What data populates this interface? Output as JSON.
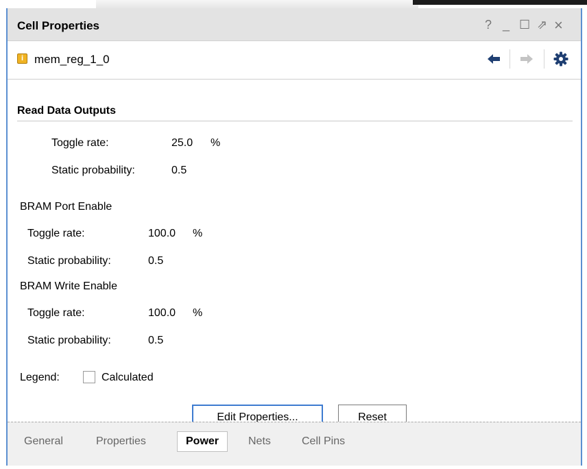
{
  "window": {
    "title": "Cell Properties",
    "controls": {
      "help": "?",
      "minimize": "_",
      "maximize": "☐",
      "float": "⇗",
      "close": "×"
    }
  },
  "cell": {
    "name": "mem_reg_1_0",
    "icon_glyph": "i"
  },
  "nav": {
    "back_icon": "arrow-left-icon",
    "forward_icon": "arrow-right-icon",
    "settings_icon": "gear-icon"
  },
  "read_data_outputs": {
    "heading": "Read Data Outputs",
    "toggle_label": "Toggle rate:",
    "toggle_value": "25.0",
    "toggle_unit": "%",
    "static_label": "Static probability:",
    "static_value": "0.5"
  },
  "bram_port_enable": {
    "heading": "BRAM Port Enable",
    "toggle_label": "Toggle rate:",
    "toggle_value": "100.0",
    "toggle_unit": "%",
    "static_label": "Static probability:",
    "static_value": "0.5"
  },
  "bram_write_enable": {
    "heading": "BRAM Write Enable",
    "toggle_label": "Toggle rate:",
    "toggle_value": "100.0",
    "toggle_unit": "%",
    "static_label": "Static probability:",
    "static_value": "0.5"
  },
  "legend": {
    "label": "Legend:",
    "item": "Calculated"
  },
  "buttons": {
    "edit": "Edit Properties...",
    "reset": "Reset"
  },
  "tabs": [
    {
      "label": "General",
      "active": false
    },
    {
      "label": "Properties",
      "active": false
    },
    {
      "label": "Power",
      "active": true
    },
    {
      "label": "Nets",
      "active": false
    },
    {
      "label": "Cell Pins",
      "active": false
    }
  ],
  "colors": {
    "accent": "#3d7bd0",
    "nav_icon": "#1f3f72",
    "cell_icon": "#f0b323"
  }
}
